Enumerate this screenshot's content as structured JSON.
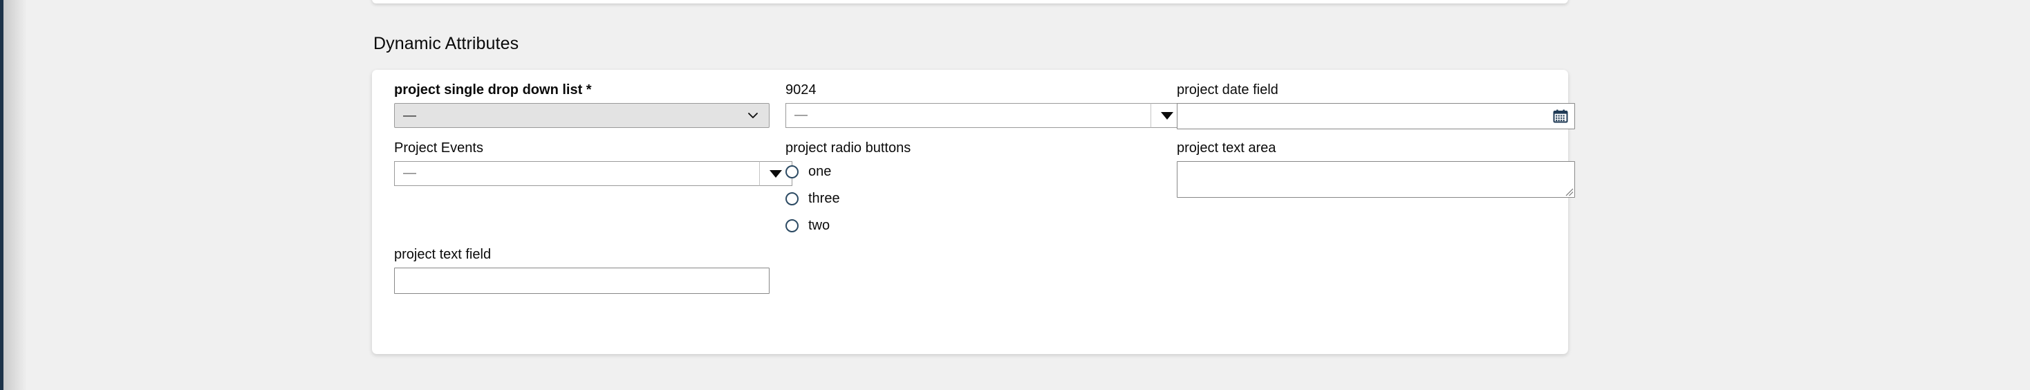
{
  "app": {
    "rail_color": "#1d3349",
    "background_color": "#f0f0f0",
    "card_color": "#ffffff"
  },
  "section": {
    "title": "Dynamic Attributes"
  },
  "form": {
    "fields": [
      {
        "id": "project-single-drop-down-list",
        "label": "project single drop down list *",
        "required": true,
        "control": "select",
        "value": "—",
        "icon": "chevron-down-icon",
        "disabled_style": true
      },
      {
        "id": "field-9024",
        "label": "9024",
        "required": false,
        "control": "combobox",
        "value": "—",
        "icon": "caret-down-icon"
      },
      {
        "id": "project-date-field",
        "label": "project date field",
        "required": false,
        "control": "date",
        "value": "",
        "icon": "calendar-icon",
        "icon_color": "#1f3a55"
      },
      {
        "id": "project-events",
        "label": "Project Events",
        "required": false,
        "control": "combobox",
        "value": "—",
        "icon": "caret-down-icon"
      },
      {
        "id": "project-radio-buttons",
        "label": "project radio buttons",
        "required": false,
        "control": "radio-group",
        "selected": null,
        "options": [
          {
            "label": "one",
            "checked": false
          },
          {
            "label": "three",
            "checked": false
          },
          {
            "label": "two",
            "checked": false
          }
        ]
      },
      {
        "id": "project-text-area",
        "label": "project text area",
        "required": false,
        "control": "textarea",
        "value": "",
        "icon": "resize-grip-icon"
      },
      {
        "id": "project-text-field",
        "label": "project text field",
        "required": false,
        "control": "text",
        "value": ""
      }
    ]
  }
}
